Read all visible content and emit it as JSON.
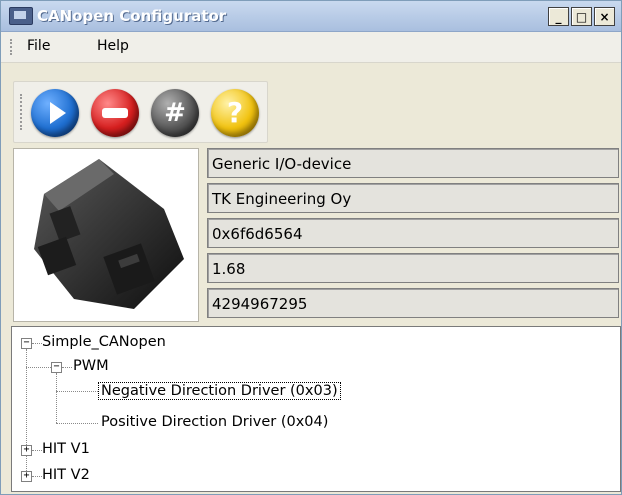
{
  "window": {
    "title": "CANopen Configurator",
    "buttons": [
      "_",
      "□",
      "×"
    ]
  },
  "menu": {
    "items": [
      "File",
      "Help"
    ]
  },
  "toolbar": {
    "buttons": [
      {
        "name": "play",
        "color": "#1f6fd1"
      },
      {
        "name": "stop",
        "color": "#d61f1f"
      },
      {
        "name": "hash",
        "color": "#585858"
      },
      {
        "name": "help",
        "color": "#f1c20f"
      }
    ],
    "help_glyph": "?",
    "hash_glyph": "#"
  },
  "device": {
    "fields": [
      "Generic I/O-device",
      "TK Engineering Oy",
      "0x6f6d6564",
      "1.68",
      "4294967295"
    ]
  },
  "tree": {
    "root": {
      "label": "Simple_CANopen",
      "expander": "−"
    },
    "pwm": {
      "label": "PWM",
      "expander": "−"
    },
    "children": [
      {
        "label": "Negative Direction Driver (0x03)",
        "selected": true
      },
      {
        "label": "Positive Direction Driver (0x04)",
        "selected": false
      }
    ],
    "hit1": {
      "label": "HIT V1",
      "expander": "+"
    },
    "hit2": {
      "label": "HIT V2",
      "expander": "+"
    }
  }
}
